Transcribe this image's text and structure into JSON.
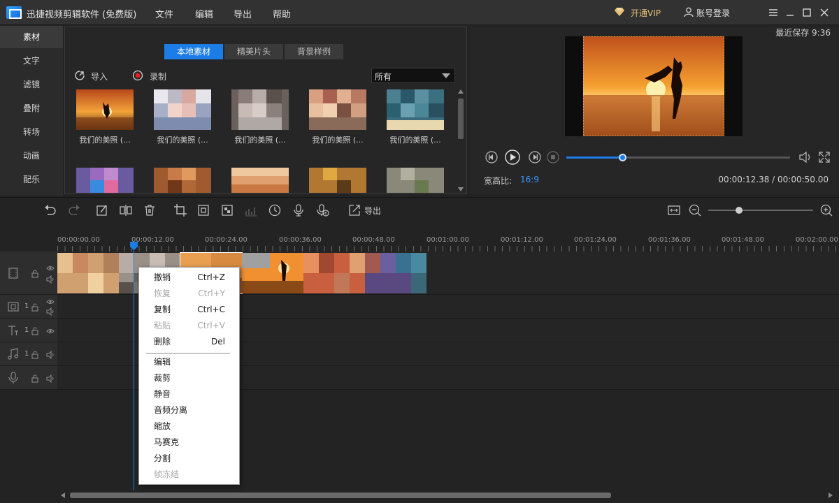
{
  "titlebar": {
    "app_title": "迅捷视频剪辑软件 (免费版)",
    "menus": [
      "文件",
      "编辑",
      "导出",
      "帮助"
    ],
    "vip_label": "开通VIP",
    "login_label": "账号登录"
  },
  "sidebar": {
    "items": [
      "素材",
      "文字",
      "滤镜",
      "叠附",
      "转场",
      "动画",
      "配乐"
    ],
    "active_index": 0
  },
  "media": {
    "tabs": [
      "本地素材",
      "精美片头",
      "背景样例"
    ],
    "active_tab": 0,
    "import_label": "导入",
    "record_label": "录制",
    "filter_value": "所有",
    "items": [
      {
        "caption": "我们的美照 (..."
      },
      {
        "caption": "我们的美照 (..."
      },
      {
        "caption": "我们的美照 (..."
      },
      {
        "caption": "我们的美照 (..."
      },
      {
        "caption": "我们的美照 (..."
      }
    ]
  },
  "preview": {
    "last_save": "最近保存 9:36",
    "aspect_label": "宽高比:",
    "aspect_value": "16:9",
    "current_time": "00:00:12.38",
    "total_time": "00:00:50.00",
    "timecode": "00:00:12.38 / 00:00:50.00",
    "progress_fraction": 0.25
  },
  "toolbar": {
    "export_label": "导出",
    "zoom_fraction": 0.26
  },
  "timeline": {
    "ruler_labels": [
      "00:00:00.00",
      "00:00:12.00",
      "00:00:24.00",
      "00:00:36.00",
      "00:00:48.00",
      "00:01:00.00",
      "00:01:12.00",
      "00:01:24.00",
      "00:01:36.00",
      "00:01:48.00",
      "00:02:00.00"
    ],
    "tracks": [
      {
        "kind": "video-main",
        "count": ""
      },
      {
        "kind": "pip",
        "count": "1"
      },
      {
        "kind": "text",
        "count": "1"
      },
      {
        "kind": "music",
        "count": "1"
      },
      {
        "kind": "voice",
        "count": ""
      }
    ]
  },
  "context_menu": {
    "items": [
      {
        "label": "撤销",
        "shortcut": "Ctrl+Z",
        "disabled": false
      },
      {
        "label": "恢复",
        "shortcut": "Ctrl+Y",
        "disabled": true
      },
      {
        "label": "复制",
        "shortcut": "Ctrl+C",
        "disabled": false
      },
      {
        "label": "粘贴",
        "shortcut": "Ctrl+V",
        "disabled": true
      },
      {
        "label": "删除",
        "shortcut": "Del",
        "disabled": false
      },
      {
        "label": "编辑",
        "shortcut": "",
        "disabled": false
      },
      {
        "label": "裁剪",
        "shortcut": "",
        "disabled": false
      },
      {
        "label": "静音",
        "shortcut": "",
        "disabled": false
      },
      {
        "label": "音频分离",
        "shortcut": "",
        "disabled": false
      },
      {
        "label": "缩放",
        "shortcut": "",
        "disabled": false
      },
      {
        "label": "马赛克",
        "shortcut": "",
        "disabled": false
      },
      {
        "label": "分割",
        "shortcut": "",
        "disabled": false
      },
      {
        "label": "帧冻结",
        "shortcut": "",
        "disabled": true
      }
    ]
  },
  "colors": {
    "accent": "#1c7de8",
    "vip": "#e8c27a",
    "aspect_value": "#3c95ff"
  }
}
